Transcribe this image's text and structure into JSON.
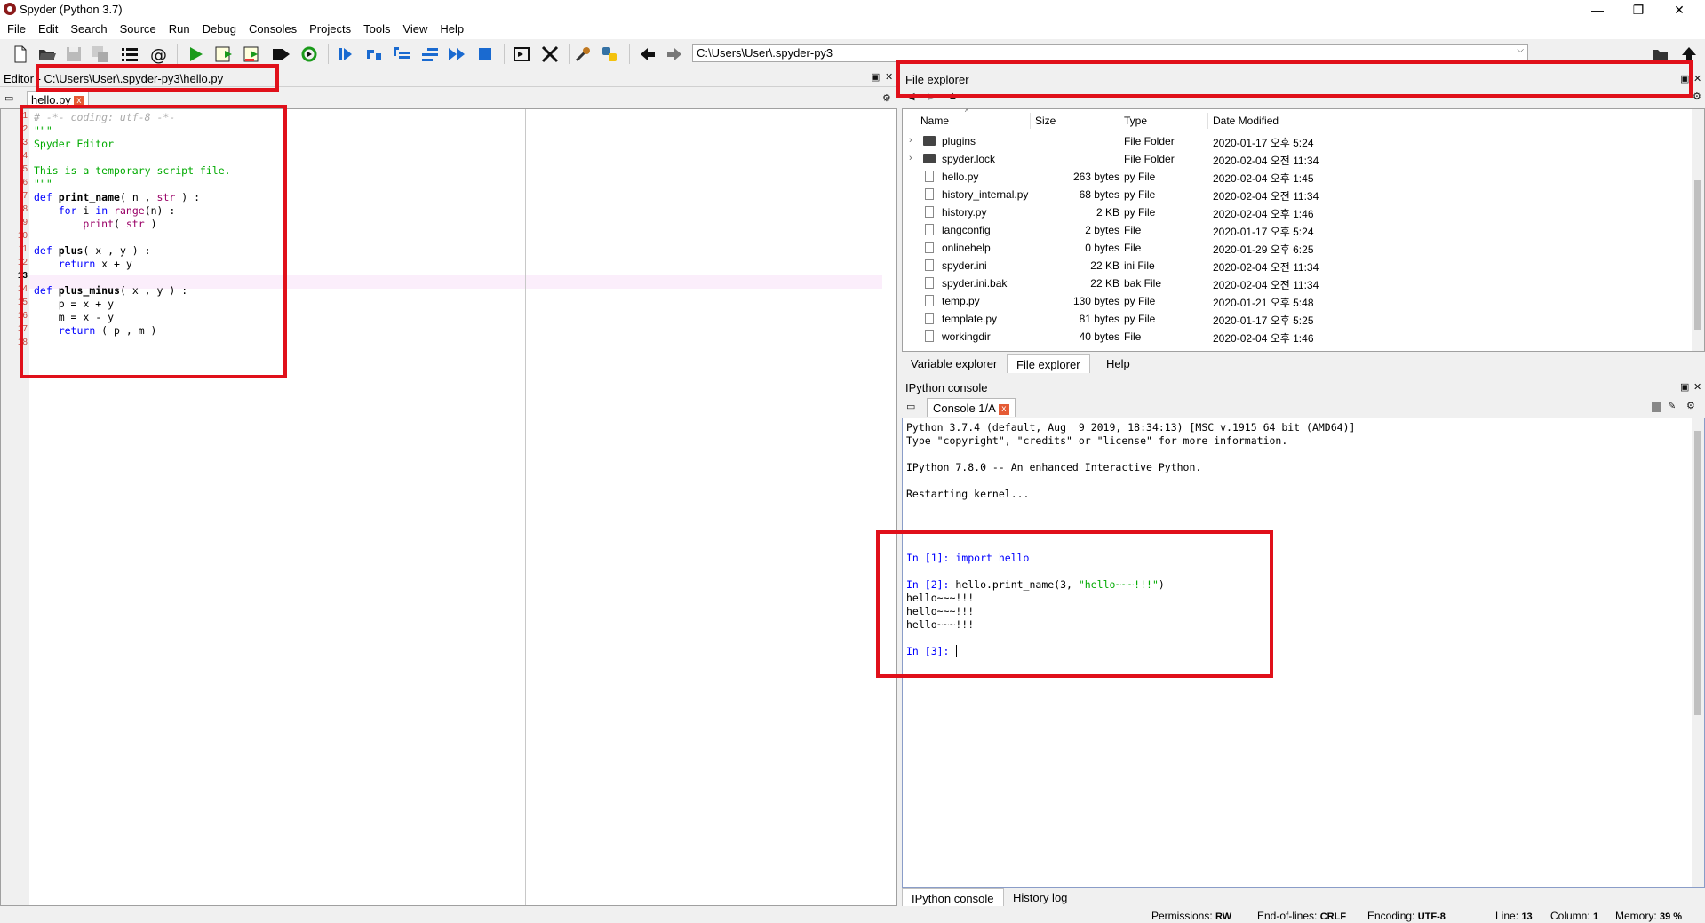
{
  "window": {
    "title": "Spyder (Python 3.7)",
    "minimize": "—",
    "restore": "❐",
    "close": "✕"
  },
  "menu": [
    "File",
    "Edit",
    "Search",
    "Source",
    "Run",
    "Debug",
    "Consoles",
    "Projects",
    "Tools",
    "View",
    "Help"
  ],
  "toolbar": {
    "path": "C:\\Users\\User\\.spyder-py3",
    "icons": [
      "new-file-icon",
      "open-file-icon",
      "save-icon",
      "save-all-icon",
      "outline-icon",
      "at-icon",
      "run-icon",
      "run-cell-icon",
      "run-cell-advance-icon",
      "run-selection-icon",
      "rerun-icon",
      "debug-icon",
      "step-icon",
      "step-into-icon",
      "step-return-icon",
      "continue-icon",
      "stop-icon",
      "maximize-pane-icon",
      "fullscreen-icon",
      "preferences-icon",
      "python-path-icon",
      "back-arrow-icon",
      "forward-arrow-icon",
      "browse-folder-icon",
      "parent-dir-icon"
    ]
  },
  "editor": {
    "header": "Editor - C:\\Users\\User\\.spyder-py3\\hello.py",
    "tab": "hello.py",
    "tab_close": "x",
    "lines": [
      {
        "n": "1",
        "text": "# -*- coding: utf-8 -*-"
      },
      {
        "n": "2",
        "text": "\"\"\""
      },
      {
        "n": "3",
        "text": "Spyder Editor"
      },
      {
        "n": "4",
        "text": ""
      },
      {
        "n": "5",
        "text": "This is a temporary script file."
      },
      {
        "n": "6",
        "text": "\"\"\""
      },
      {
        "n": "7",
        "text": "def print_name( n , str ) :"
      },
      {
        "n": "8",
        "text": "    for i in range(n) :"
      },
      {
        "n": "9",
        "text": "        print( str )"
      },
      {
        "n": "10",
        "text": ""
      },
      {
        "n": "11",
        "text": "def plus( x , y ) :"
      },
      {
        "n": "12",
        "text": "    return x + y"
      },
      {
        "n": "13",
        "text": ""
      },
      {
        "n": "14",
        "text": "def plus_minus( x , y ) :"
      },
      {
        "n": "15",
        "text": "    p = x + y"
      },
      {
        "n": "16",
        "text": "    m = x - y"
      },
      {
        "n": "17",
        "text": "    return ( p , m )"
      },
      {
        "n": "18",
        "text": ""
      }
    ]
  },
  "file_explorer": {
    "header": "File explorer",
    "columns": [
      "Name",
      "Size",
      "Type",
      "Date Modified"
    ],
    "rows": [
      {
        "name": "plugins",
        "size": "",
        "type": "File Folder",
        "date": "2020-01-17 오후 5:24",
        "folder": true
      },
      {
        "name": "spyder.lock",
        "size": "",
        "type": "File Folder",
        "date": "2020-02-04 오전 11:34",
        "folder": true
      },
      {
        "name": "hello.py",
        "size": "263 bytes",
        "type": "py File",
        "date": "2020-02-04 오후 1:45",
        "folder": false
      },
      {
        "name": "history_internal.py",
        "size": "68 bytes",
        "type": "py File",
        "date": "2020-02-04 오전 11:34",
        "folder": false
      },
      {
        "name": "history.py",
        "size": "2 KB",
        "type": "py File",
        "date": "2020-02-04 오후 1:46",
        "folder": false
      },
      {
        "name": "langconfig",
        "size": "2 bytes",
        "type": "File",
        "date": "2020-01-17 오후 5:24",
        "folder": false
      },
      {
        "name": "onlinehelp",
        "size": "0 bytes",
        "type": "File",
        "date": "2020-01-29 오후 6:25",
        "folder": false
      },
      {
        "name": "spyder.ini",
        "size": "22 KB",
        "type": "ini File",
        "date": "2020-02-04 오전 11:34",
        "folder": false
      },
      {
        "name": "spyder.ini.bak",
        "size": "22 KB",
        "type": "bak File",
        "date": "2020-02-04 오전 11:34",
        "folder": false
      },
      {
        "name": "temp.py",
        "size": "130 bytes",
        "type": "py File",
        "date": "2020-01-21 오후 5:48",
        "folder": false
      },
      {
        "name": "template.py",
        "size": "81 bytes",
        "type": "py File",
        "date": "2020-01-17 오후 5:25",
        "folder": false
      },
      {
        "name": "workingdir",
        "size": "40 bytes",
        "type": "File",
        "date": "2020-02-04 오후 1:46",
        "folder": false
      }
    ],
    "tabs": [
      "Variable explorer",
      "File explorer",
      "Help"
    ]
  },
  "ipython": {
    "header": "IPython console",
    "tab": "Console 1/A",
    "tab_close": "x",
    "banner": [
      "Python 3.7.4 (default, Aug  9 2019, 18:34:13) [MSC v.1915 64 bit (AMD64)]",
      "Type \"copyright\", \"credits\" or \"license\" for more information.",
      "",
      "IPython 7.8.0 -- An enhanced Interactive Python.",
      "",
      "Restarting kernel..."
    ],
    "session": {
      "p1": "In [1]: ",
      "c1": "import hello",
      "p2": "In [2]: ",
      "c2a": "hello.print_name(3, ",
      "c2b": "\"hello~~~!!!\"",
      "c2c": ")",
      "out1": "hello~~~!!!",
      "out2": "hello~~~!!!",
      "out3": "hello~~~!!!",
      "p3": "In [3]: "
    },
    "bottom_tabs": [
      "IPython console",
      "History log"
    ]
  },
  "status": {
    "permissions_label": "Permissions:",
    "permissions": "RW",
    "eol_label": "End-of-lines:",
    "eol": "CRLF",
    "encoding_label": "Encoding:",
    "encoding": "UTF-8",
    "line_label": "Line:",
    "line": "13",
    "column_label": "Column:",
    "column": "1",
    "memory_label": "Memory:",
    "memory": "39 %"
  },
  "colors": {
    "highlight": "#e0101a",
    "keyword": "#0000ff",
    "string": "#00aa00",
    "comment": "#aaaaaa",
    "line_number": "#c6453c"
  }
}
